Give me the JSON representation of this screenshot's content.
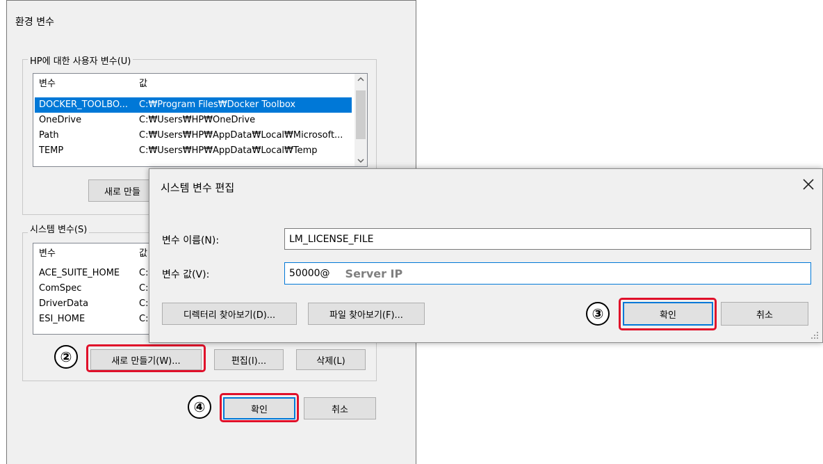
{
  "env_window": {
    "title": "환경 변수",
    "user_group_label": "HP에 대한 사용자 변수(U)",
    "user_columns": [
      "변수",
      "값"
    ],
    "user_rows": [
      {
        "name": "DOCKER_TOOLBO...",
        "value": "C:₩Program Files₩Docker Toolbox",
        "selected": true
      },
      {
        "name": "OneDrive",
        "value": "C:₩Users₩HP₩OneDrive",
        "selected": false
      },
      {
        "name": "Path",
        "value": "C:₩Users₩HP₩AppData₩Local₩Microsoft...",
        "selected": false
      },
      {
        "name": "TEMP",
        "value": "C:₩Users₩HP₩AppData₩Local₩Temp",
        "selected": false
      }
    ],
    "user_new_button_partial": "새로 만들",
    "system_group_label": "시스템 변수(S)",
    "system_columns": [
      "변수",
      "값"
    ],
    "system_rows": [
      {
        "name": "ACE_SUITE_HOME",
        "value": "C:"
      },
      {
        "name": "ComSpec",
        "value": "C:"
      },
      {
        "name": "DriverData",
        "value": "C:"
      },
      {
        "name": "ESI_HOME",
        "value": "C:"
      }
    ],
    "system_new_button": "새로 만들기(W)...",
    "system_edit_button": "편집(I)...",
    "system_delete_button": "삭제(L)",
    "ok_button": "확인",
    "cancel_button": "취소"
  },
  "edit_dialog": {
    "title": "시스템 변수 편집",
    "close_glyph": "✕",
    "name_label": "변수 이름(N):",
    "name_value": "LM_LICENSE_FILE",
    "value_label": "변수 값(V):",
    "value_prefix": "50000@",
    "value_hint": "Server IP",
    "browse_dir_button": "디렉터리 찾아보기(D)...",
    "browse_file_button": "파일 찾아보기(F)...",
    "ok_button": "확인",
    "cancel_button": "취소"
  },
  "annotations": {
    "step2": "②",
    "step3": "③",
    "step4": "④",
    "highlight_color": "#e0102a"
  },
  "icons": {
    "scroll_up": "chevron-up-icon",
    "scroll_down": "chevron-down-icon",
    "close": "close-icon",
    "resize": "resize-grip-icon"
  }
}
